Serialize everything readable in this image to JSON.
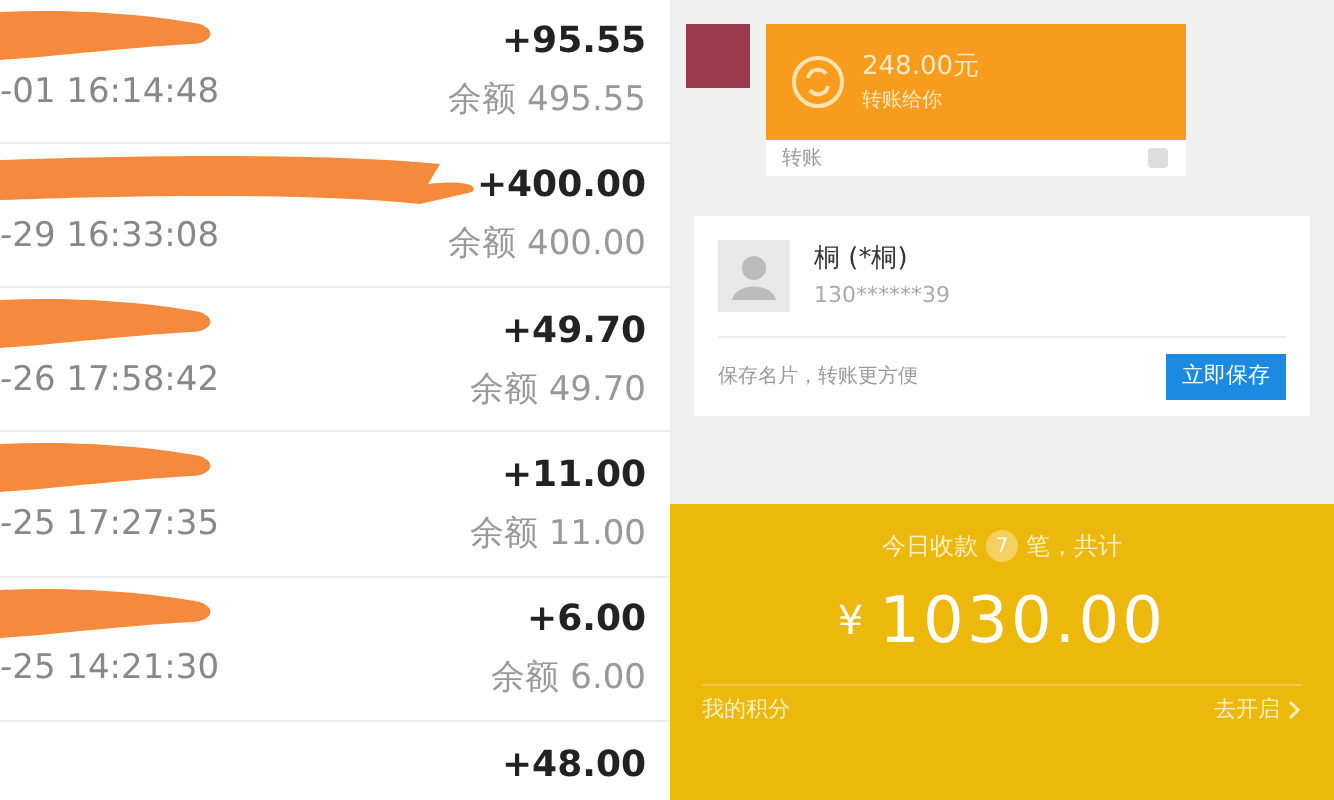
{
  "transactions": [
    {
      "date": "-01 16:14:48",
      "amount": "+95.55",
      "balance_label": "余额",
      "balance": "495.55"
    },
    {
      "date": "-29 16:33:08",
      "amount": "+400.00",
      "balance_label": "余额",
      "balance": "400.00"
    },
    {
      "date": "-26 17:58:42",
      "amount": "+49.70",
      "balance_label": "余额",
      "balance": "49.70"
    },
    {
      "date": "-25 17:27:35",
      "amount": "+11.00",
      "balance_label": "余额",
      "balance": "11.00"
    },
    {
      "date": "-25 14:21:30",
      "amount": "+6.00",
      "balance_label": "余额",
      "balance": "6.00"
    },
    {
      "amount": "+48.00"
    }
  ],
  "transfer_message": {
    "amount": "248.00元",
    "note": "转账给你",
    "footer": "转账"
  },
  "contact_card": {
    "name": "桐 (*桐)",
    "phone": "130******39",
    "hint": "保存名片，转账更方便",
    "button": "立即保存"
  },
  "today_summary": {
    "prefix": "今日收款",
    "count": "7",
    "suffix": "笔，共计",
    "currency": "¥",
    "total": "1030.00",
    "points_label": "我的积分",
    "points_action": "去开启"
  }
}
